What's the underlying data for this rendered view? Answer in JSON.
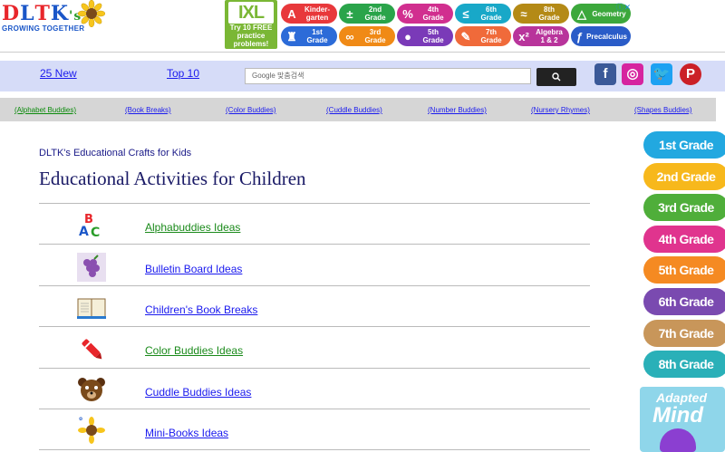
{
  "logo": {
    "letters": [
      "D",
      "L",
      "T",
      "K",
      "'s"
    ],
    "letter_colors": [
      "#e8262b",
      "#1a56c8",
      "#e8262b",
      "#1a56c8",
      "#2a9d2a"
    ],
    "subtitle": "Growing Together"
  },
  "top_ad": {
    "ixl_logo": "IXL",
    "ixl_text": "Try 10 FREE practice problems!",
    "buttons": [
      {
        "glyph": "A",
        "label": "Kinder-\ngarten",
        "color": "#e8383b"
      },
      {
        "glyph": "±",
        "label": "2nd\nGrade",
        "color": "#2aa44a"
      },
      {
        "glyph": "%",
        "label": "4th\nGrade",
        "color": "#d12f8f"
      },
      {
        "glyph": "≤",
        "label": "6th\nGrade",
        "color": "#18a8c8"
      },
      {
        "glyph": "≈",
        "label": "8th\nGrade",
        "color": "#b48a16"
      },
      {
        "glyph": "△",
        "label": "Geometry",
        "color": "#3ca83c"
      },
      {
        "glyph": "♜",
        "label": "1st\nGrade",
        "color": "#2c6bd8"
      },
      {
        "glyph": "∞",
        "label": "3rd\nGrade",
        "color": "#f08a16"
      },
      {
        "glyph": "●",
        "label": "5th\nGrade",
        "color": "#7a3ab8"
      },
      {
        "glyph": "✎",
        "label": "7th\nGrade",
        "color": "#f06a3a"
      },
      {
        "glyph": "x²",
        "label": "Algebra\n1 & 2",
        "color": "#b8349b"
      },
      {
        "glyph": "ƒ",
        "label": "Precalculus",
        "color": "#2a5cc8"
      }
    ],
    "close_label": "ⓘ✕"
  },
  "nav": {
    "new_label": "25 New",
    "top_label": "Top 10",
    "search_placeholder": "Google 맞춤검색",
    "search_button": "🔍",
    "social": [
      {
        "name": "facebook-icon",
        "glyph": "f",
        "color": "#3b5998"
      },
      {
        "name": "instagram-icon",
        "glyph": "◎",
        "color": "#d6249f"
      },
      {
        "name": "twitter-icon",
        "glyph": "🐦",
        "color": "#1da1f2"
      },
      {
        "name": "pinterest-icon",
        "glyph": "P",
        "color": "#cb2027"
      }
    ]
  },
  "buddies": [
    {
      "label": "(Alphabet Buddies)",
      "green": true
    },
    {
      "label": "(Book Breaks)",
      "green": false
    },
    {
      "label": "(Color Buddies)",
      "green": false
    },
    {
      "label": "(Cuddle Buddies)",
      "green": false
    },
    {
      "label": "(Number Buddies)",
      "green": false
    },
    {
      "label": "(Nursery Rhymes)",
      "green": false
    },
    {
      "label": "(Shapes Buddies)",
      "green": false
    }
  ],
  "main": {
    "breadcrumb": "DLTK's Educational Crafts for Kids",
    "title": "Educational Activities for Children",
    "rows": [
      {
        "label": "Alphabuddies Ideas",
        "color": "#1a8a1a",
        "icon": "abc-icon"
      },
      {
        "label": "Bulletin Board Ideas",
        "color": "#1a1aee",
        "icon": "grapes-icon"
      },
      {
        "label": "Children's Book Breaks",
        "color": "#1a1aee",
        "icon": "book-icon"
      },
      {
        "label": "Color Buddies Ideas",
        "color": "#1a8a1a",
        "icon": "crayon-icon"
      },
      {
        "label": "Cuddle Buddies Ideas",
        "color": "#1a1aee",
        "icon": "bear-icon"
      },
      {
        "label": "Mini-Books Ideas",
        "color": "#1a1aee",
        "icon": "flower-icon"
      }
    ]
  },
  "side_ad": {
    "grades": [
      {
        "label": "1st Grade",
        "color": "#22a8e0"
      },
      {
        "label": "2nd Grade",
        "color": "#f7b81c"
      },
      {
        "label": "3rd Grade",
        "color": "#4fae3a"
      },
      {
        "label": "4th Grade",
        "color": "#e0348e"
      },
      {
        "label": "5th Grade",
        "color": "#f58a22"
      },
      {
        "label": "6th Grade",
        "color": "#7a4ab0"
      },
      {
        "label": "7th Grade",
        "color": "#c8965a"
      },
      {
        "label": "8th Grade",
        "color": "#2ab0b8"
      }
    ],
    "adapted_1": "Adapted",
    "adapted_2": "Mind"
  }
}
